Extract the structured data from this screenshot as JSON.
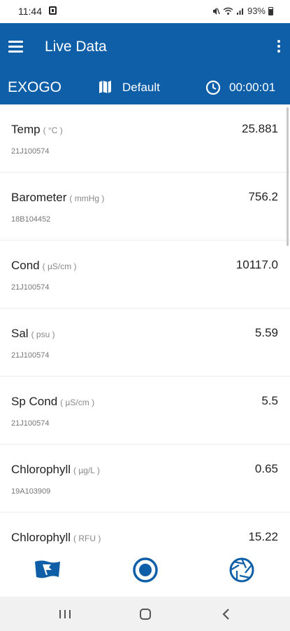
{
  "status_bar": {
    "time": "11:44",
    "battery": "93%"
  },
  "app_bar": {
    "title": "Live Data"
  },
  "sub_bar": {
    "device_name": "EXOGO",
    "profile": "Default",
    "elapsed": "00:00:01"
  },
  "parameters": [
    {
      "name": "Temp",
      "unit": "( °C )",
      "value": "25.881",
      "serial": "21J100574"
    },
    {
      "name": "Barometer",
      "unit": "( mmHg )",
      "value": "756.2",
      "serial": "18B104452"
    },
    {
      "name": "Cond",
      "unit": "( µS/cm )",
      "value": "10117.0",
      "serial": "21J100574"
    },
    {
      "name": "Sal",
      "unit": "( psu )",
      "value": "5.59",
      "serial": "21J100574"
    },
    {
      "name": "Sp Cond",
      "unit": "( µS/cm )",
      "value": "5.5",
      "serial": "21J100574"
    },
    {
      "name": "Chlorophyll",
      "unit": "( µg/L )",
      "value": "0.65",
      "serial": "19A103909"
    },
    {
      "name": "Chlorophyll",
      "unit": "( RFU )",
      "value": "15.22",
      "serial": ""
    }
  ],
  "bottom_bar": {
    "icons": [
      "site-flag-icon",
      "record-icon",
      "camera-shutter-icon"
    ]
  },
  "colors": {
    "primary": "#0f5fa8",
    "text": "#222222",
    "secondary_text": "#777777"
  }
}
